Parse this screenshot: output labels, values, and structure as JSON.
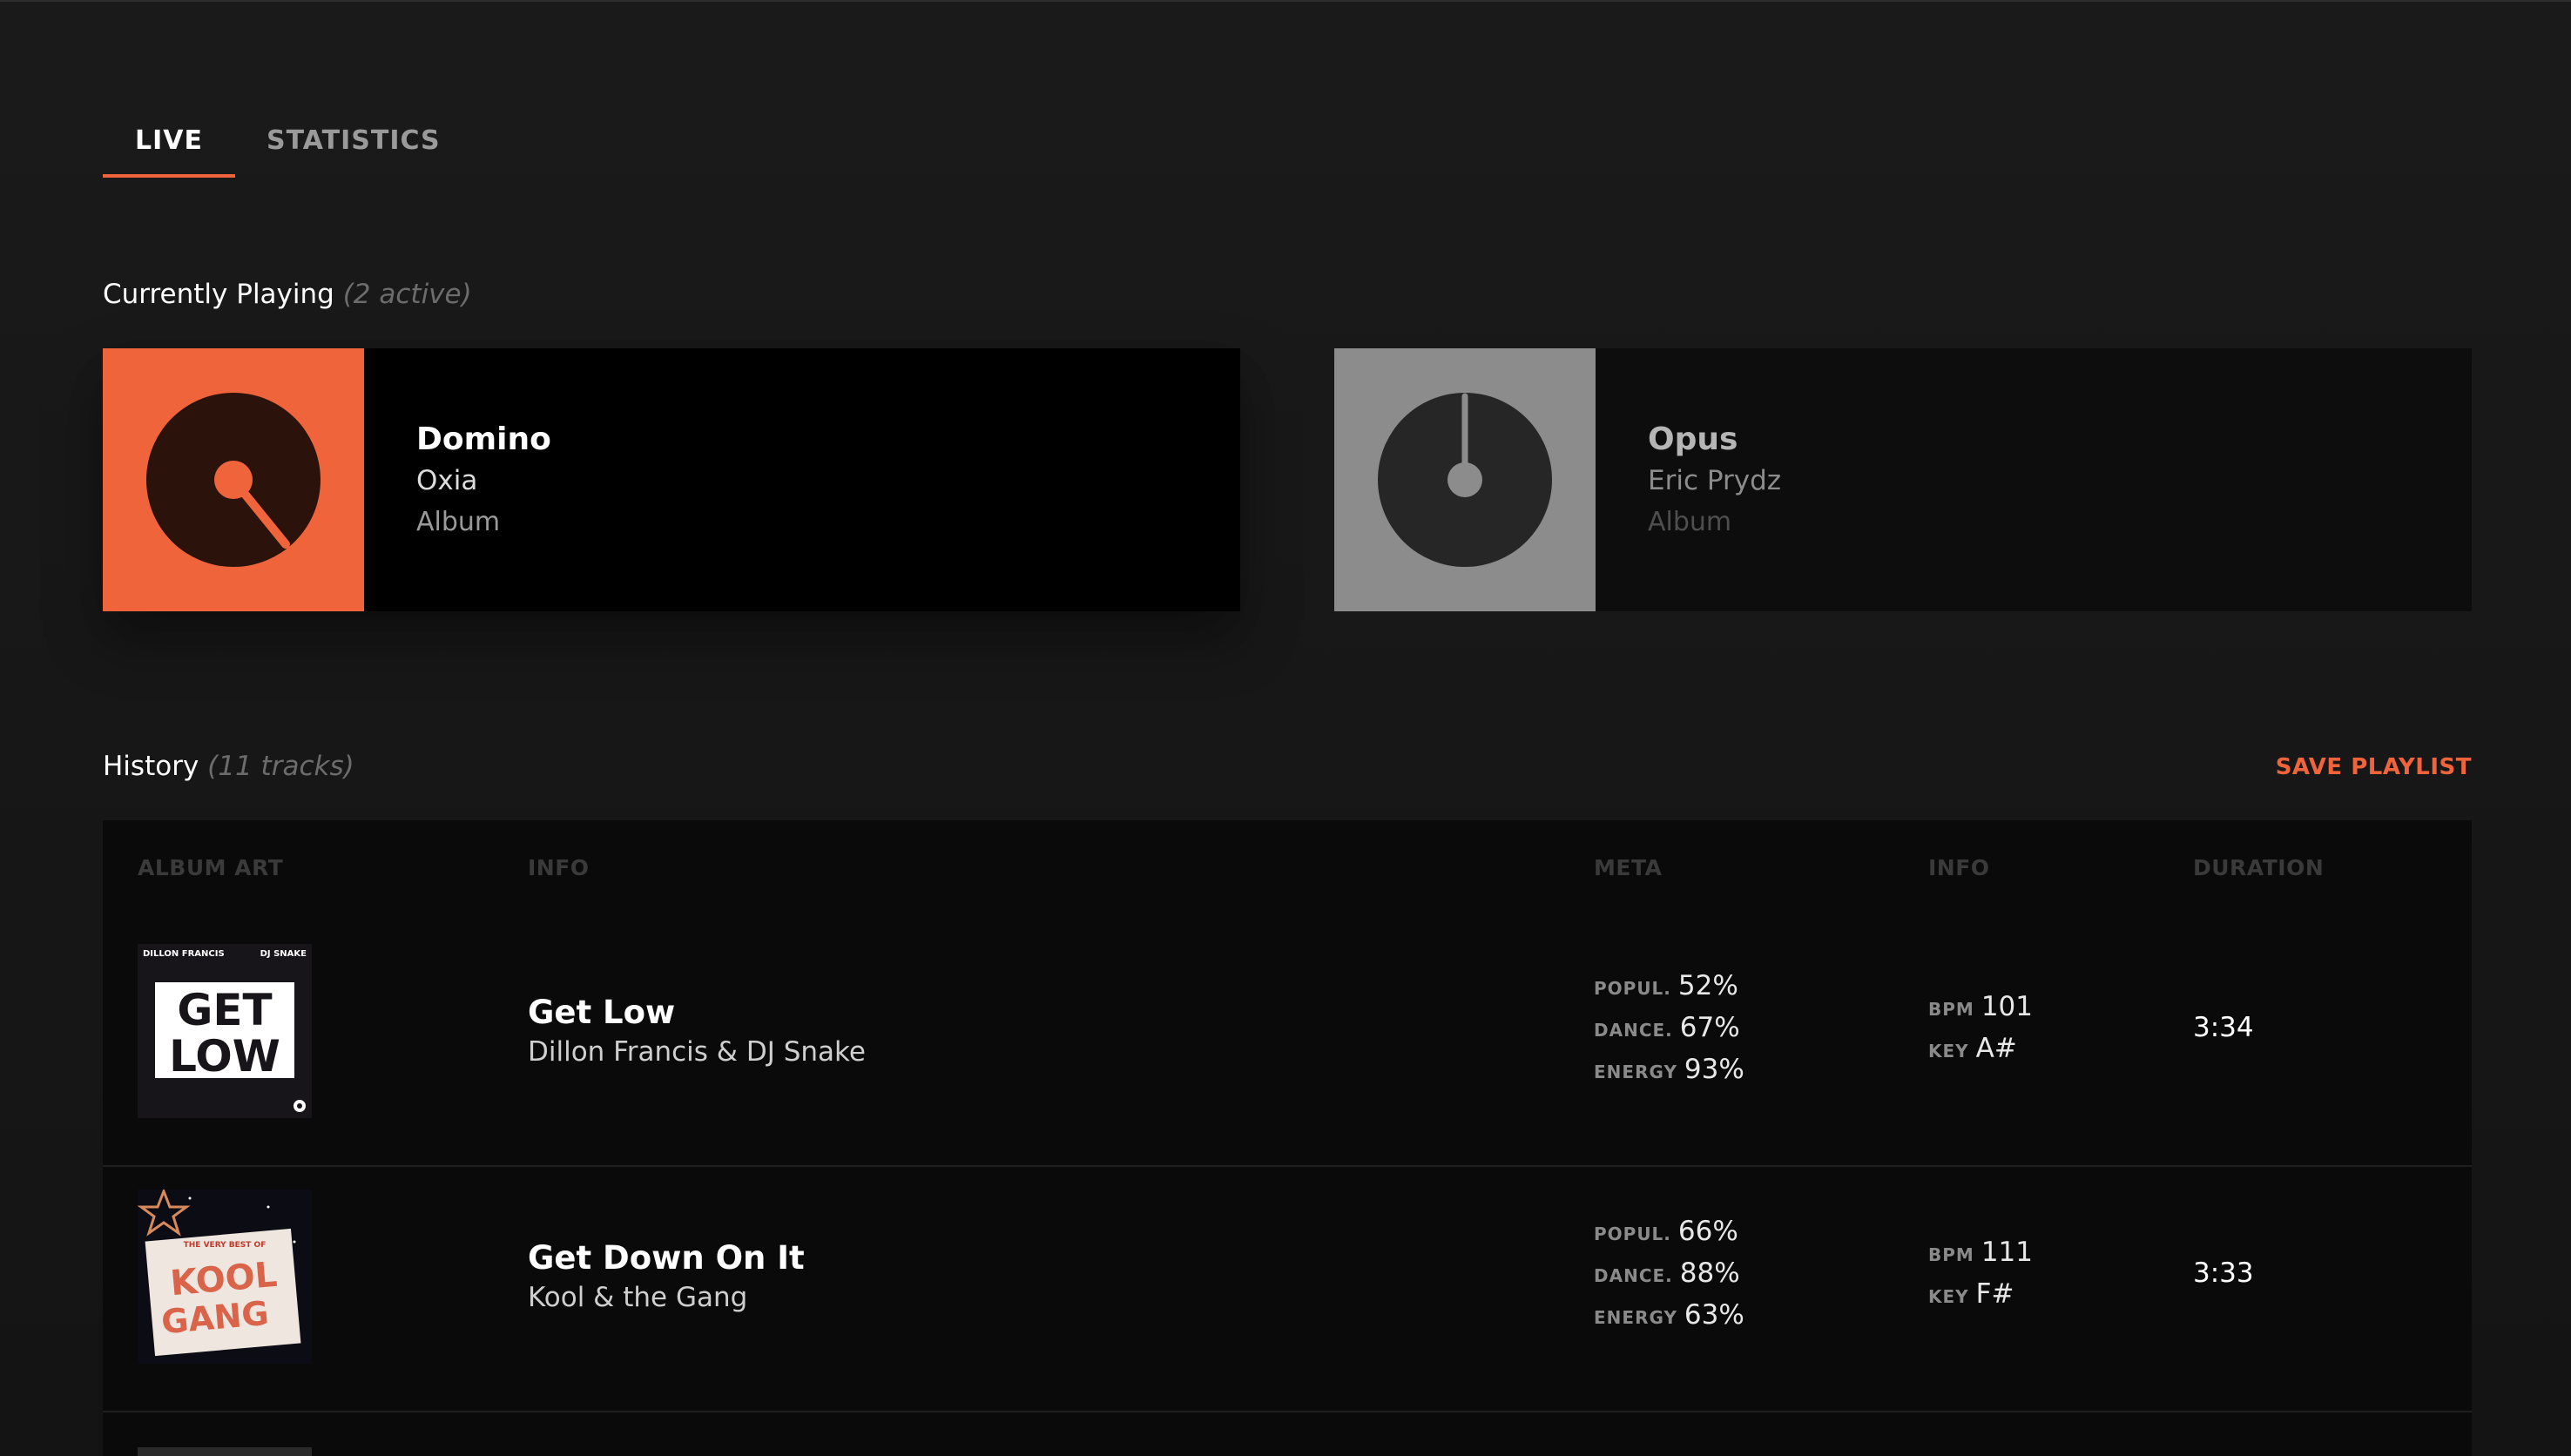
{
  "tabs": {
    "live": "LIVE",
    "statistics": "STATISTICS"
  },
  "now_playing": {
    "heading": "Currently Playing",
    "count_text": "(2 active)",
    "cards": [
      {
        "title": "Domino",
        "artist": "Oxia",
        "album": "Album",
        "art_color": "#f0643c",
        "state": "playing"
      },
      {
        "title": "Opus",
        "artist": "Eric Prydz",
        "album": "Album",
        "art_color": "#8c8c8c",
        "state": "idle"
      }
    ]
  },
  "history": {
    "heading": "History",
    "count_text": "(11 tracks)",
    "save_label": "SAVE PLAYLIST",
    "columns": [
      "ALBUM ART",
      "INFO",
      "META",
      "INFO",
      "DURATION"
    ],
    "rows": [
      {
        "track": "Get Low",
        "artist": "Dillon Francis & DJ Snake",
        "art": {
          "top_left": "DILLON FRANCIS",
          "top_right": "DJ SNAKE",
          "line1": "GET",
          "line2": "LOW"
        },
        "popul": "52%",
        "dance": "67%",
        "energy": "93%",
        "bpm": "101",
        "key": "A#",
        "duration": "3:34"
      },
      {
        "track": "Get Down On It",
        "artist": "Kool & the Gang",
        "art": {
          "top": "THE VERY BEST OF",
          "line1": "KOOL",
          "line2": "GANG"
        },
        "popul": "66%",
        "dance": "88%",
        "energy": "63%",
        "bpm": "111",
        "key": "F#",
        "duration": "3:33"
      }
    ]
  },
  "labels": {
    "popul": "POPUL.",
    "dance": "DANCE.",
    "energy": "ENERGY",
    "bpm": "BPM",
    "key": "KEY"
  },
  "colors": {
    "accent": "#f0643c",
    "background": "#141414",
    "card": "#000000"
  }
}
